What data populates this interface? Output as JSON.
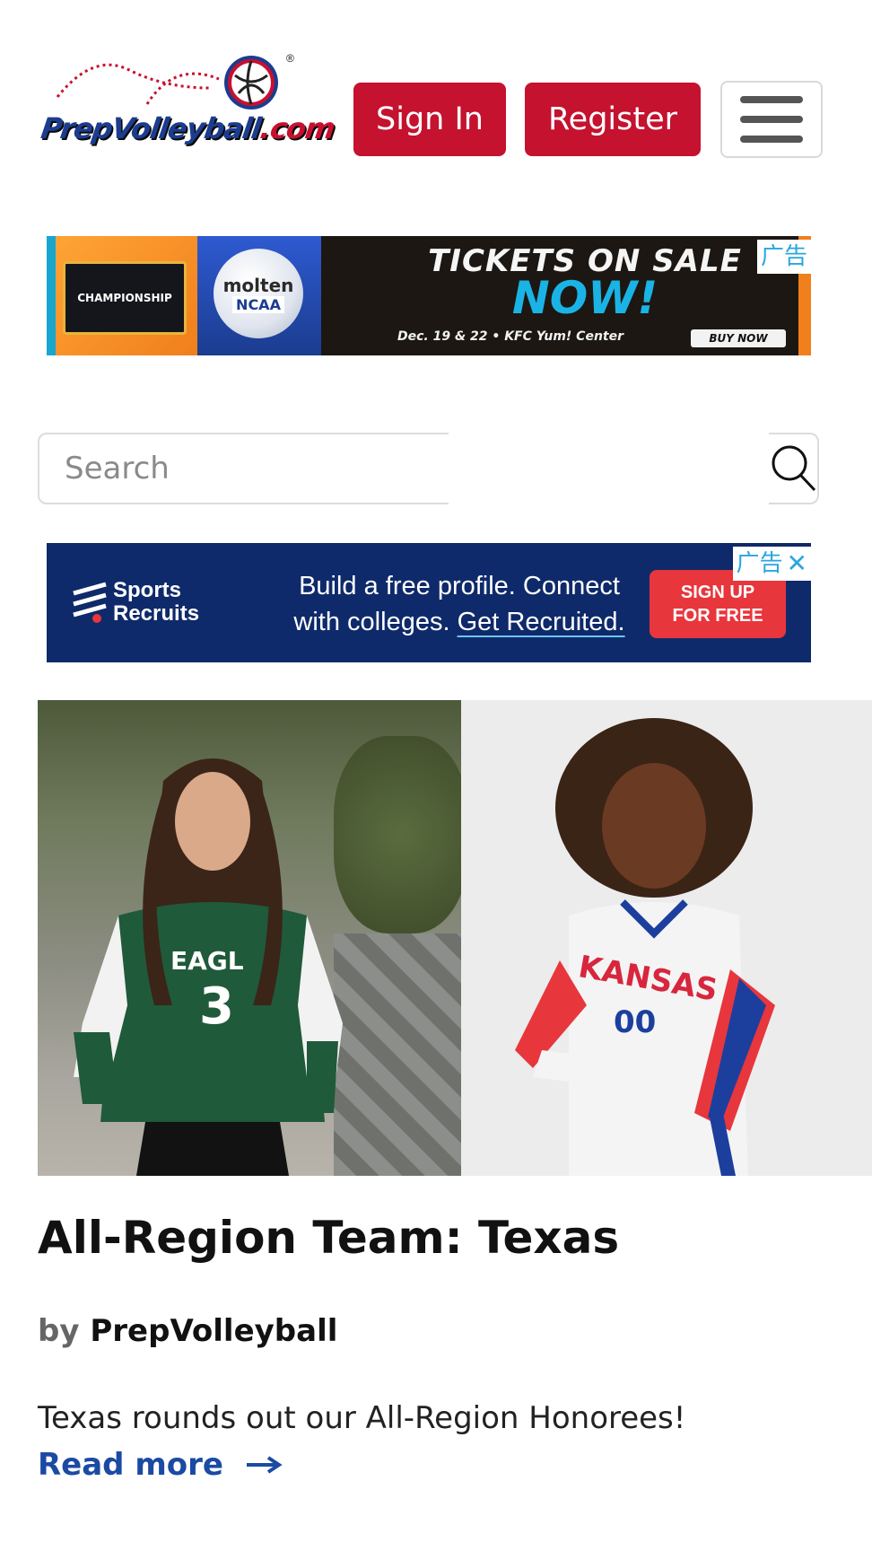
{
  "header": {
    "logo_text_main": "PrepVolleyball",
    "logo_text_tld": ".com",
    "logo_reg": "®",
    "signin_label": "Sign In",
    "register_label": "Register",
    "menu_icon": "hamburger-menu-icon"
  },
  "ad_top": {
    "label_tag": "广告",
    "championship_text": "CHAMPIONSHIP",
    "ball_brand": "molten",
    "ball_league": "NCAA",
    "headline_1": "TICKETS ON SALE",
    "headline_2": "NOW!",
    "details": "Dec. 19 & 22 • KFC Yum! Center",
    "button": "BUY NOW"
  },
  "search": {
    "placeholder": "Search",
    "icon": "search-icon"
  },
  "ad_middle": {
    "label_tag": "广告",
    "close_icon": "✕",
    "brand": "Sports\nRecruits",
    "headline_a": "Build a free profile. Connect",
    "headline_b": "with colleges.",
    "headline_c": "Get Recruited.",
    "cta": "SIGN UP\nFOR FREE"
  },
  "hero": {
    "left_jersey_text": "EAGL",
    "left_jersey_number": "3",
    "right_jersey_text": "KANSAS",
    "right_jersey_number": "00"
  },
  "article": {
    "title": "All-Region Team: Texas",
    "by_label": "by",
    "author": "PrepVolleyball",
    "summary": "Texas rounds out our All-Region Honorees!",
    "read_more": "Read more",
    "read_more_icon": "arrow-right-icon"
  },
  "colors": {
    "brand_red": "#c4122f",
    "link_blue": "#1b4aa3",
    "ad_blue": "#0f2a6a"
  }
}
